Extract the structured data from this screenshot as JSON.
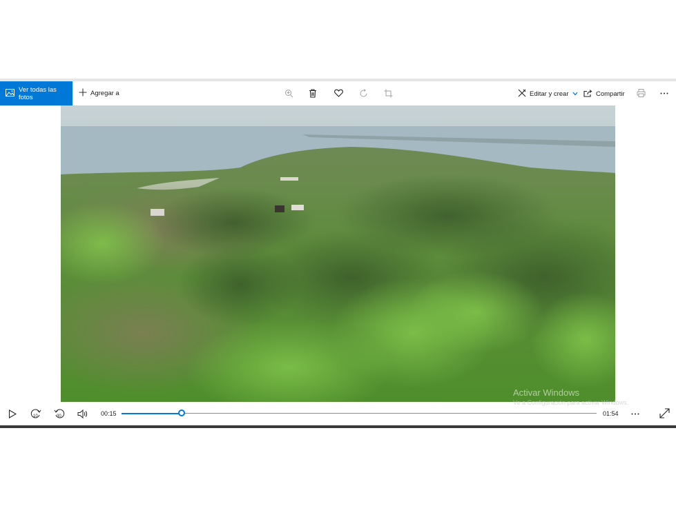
{
  "toolbar": {
    "view_all_label": "Ver todas las fotos",
    "add_to_label": "Agregar a",
    "edit_create_label": "Editar y crear",
    "share_label": "Compartir",
    "accent": "#0078d7"
  },
  "player": {
    "current_time": "00:15",
    "total_time": "01:54",
    "progress": 0.127,
    "skip_back_label": "10",
    "skip_forward_label": "30"
  },
  "watermark": {
    "title": "Activar Windows",
    "subtitle": "Ve a Configuración para activar Windows."
  }
}
